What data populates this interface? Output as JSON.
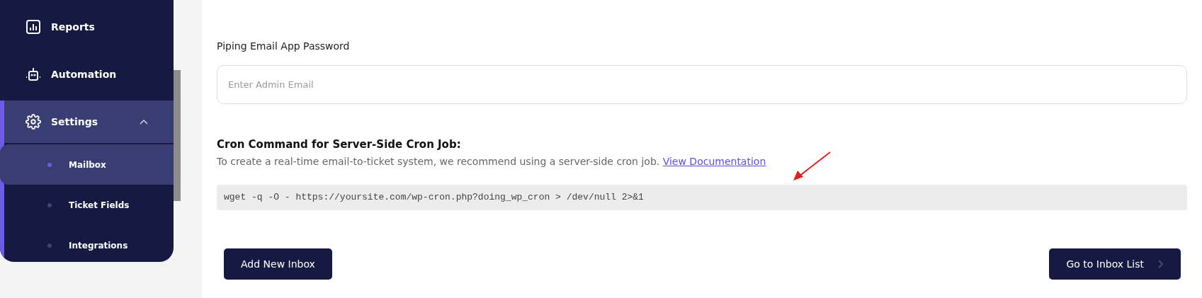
{
  "sidebar": {
    "items": [
      {
        "label": "Reports",
        "kind": "chart",
        "selected": false
      },
      {
        "label": "Automation",
        "kind": "robot",
        "selected": false
      },
      {
        "label": "Settings",
        "kind": "gear",
        "selected": true,
        "expanded": true,
        "children": [
          {
            "label": "Mailbox",
            "selected": true
          },
          {
            "label": "Ticket Fields",
            "selected": false
          },
          {
            "label": "Integrations",
            "selected": false
          }
        ]
      }
    ]
  },
  "form": {
    "field_label": "Piping Email App Password",
    "field": {
      "placeholder": "Enter Admin Email"
    },
    "cron_heading": "Cron Command for Server-Side Cron Job:",
    "cron_description": "To create a real-time email-to-ticket system, we recommend using a server-side cron job.",
    "doc_link": "View Documentation",
    "command": "wget -q -O - https://yoursite.com/wp-cron.php?doing_wp_cron > /dev/null 2>&1"
  },
  "buttons": [
    {
      "label": "Add New Inbox",
      "kind": "plain"
    },
    {
      "label": "Go to Inbox List",
      "kind": "next"
    }
  ]
}
